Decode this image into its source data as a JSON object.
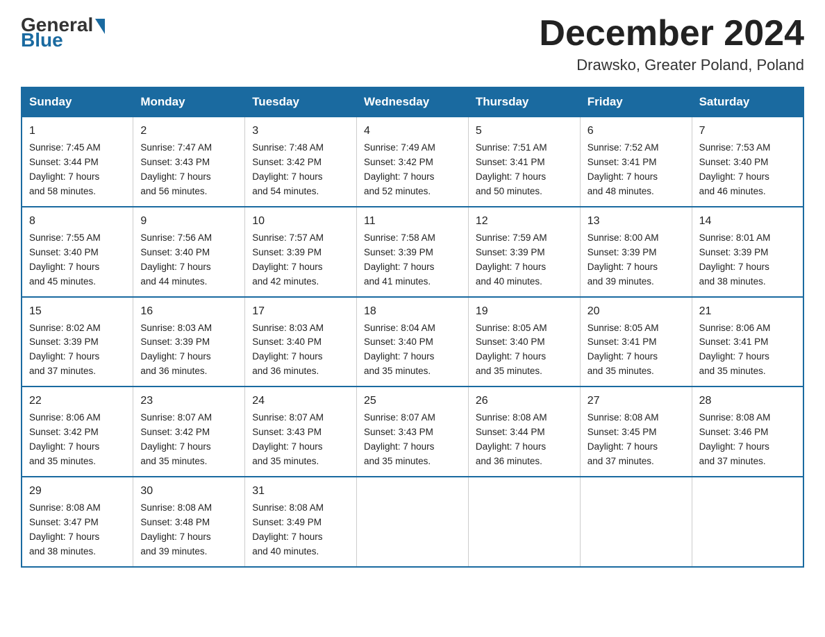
{
  "logo": {
    "general": "General",
    "blue": "Blue",
    "arrow_color": "#1a6aa0"
  },
  "header": {
    "month_title": "December 2024",
    "location": "Drawsko, Greater Poland, Poland"
  },
  "days_of_week": [
    "Sunday",
    "Monday",
    "Tuesday",
    "Wednesday",
    "Thursday",
    "Friday",
    "Saturday"
  ],
  "weeks": [
    [
      {
        "day": "1",
        "sunrise": "7:45 AM",
        "sunset": "3:44 PM",
        "daylight": "7 hours and 58 minutes."
      },
      {
        "day": "2",
        "sunrise": "7:47 AM",
        "sunset": "3:43 PM",
        "daylight": "7 hours and 56 minutes."
      },
      {
        "day": "3",
        "sunrise": "7:48 AM",
        "sunset": "3:42 PM",
        "daylight": "7 hours and 54 minutes."
      },
      {
        "day": "4",
        "sunrise": "7:49 AM",
        "sunset": "3:42 PM",
        "daylight": "7 hours and 52 minutes."
      },
      {
        "day": "5",
        "sunrise": "7:51 AM",
        "sunset": "3:41 PM",
        "daylight": "7 hours and 50 minutes."
      },
      {
        "day": "6",
        "sunrise": "7:52 AM",
        "sunset": "3:41 PM",
        "daylight": "7 hours and 48 minutes."
      },
      {
        "day": "7",
        "sunrise": "7:53 AM",
        "sunset": "3:40 PM",
        "daylight": "7 hours and 46 minutes."
      }
    ],
    [
      {
        "day": "8",
        "sunrise": "7:55 AM",
        "sunset": "3:40 PM",
        "daylight": "7 hours and 45 minutes."
      },
      {
        "day": "9",
        "sunrise": "7:56 AM",
        "sunset": "3:40 PM",
        "daylight": "7 hours and 44 minutes."
      },
      {
        "day": "10",
        "sunrise": "7:57 AM",
        "sunset": "3:39 PM",
        "daylight": "7 hours and 42 minutes."
      },
      {
        "day": "11",
        "sunrise": "7:58 AM",
        "sunset": "3:39 PM",
        "daylight": "7 hours and 41 minutes."
      },
      {
        "day": "12",
        "sunrise": "7:59 AM",
        "sunset": "3:39 PM",
        "daylight": "7 hours and 40 minutes."
      },
      {
        "day": "13",
        "sunrise": "8:00 AM",
        "sunset": "3:39 PM",
        "daylight": "7 hours and 39 minutes."
      },
      {
        "day": "14",
        "sunrise": "8:01 AM",
        "sunset": "3:39 PM",
        "daylight": "7 hours and 38 minutes."
      }
    ],
    [
      {
        "day": "15",
        "sunrise": "8:02 AM",
        "sunset": "3:39 PM",
        "daylight": "7 hours and 37 minutes."
      },
      {
        "day": "16",
        "sunrise": "8:03 AM",
        "sunset": "3:39 PM",
        "daylight": "7 hours and 36 minutes."
      },
      {
        "day": "17",
        "sunrise": "8:03 AM",
        "sunset": "3:40 PM",
        "daylight": "7 hours and 36 minutes."
      },
      {
        "day": "18",
        "sunrise": "8:04 AM",
        "sunset": "3:40 PM",
        "daylight": "7 hours and 35 minutes."
      },
      {
        "day": "19",
        "sunrise": "8:05 AM",
        "sunset": "3:40 PM",
        "daylight": "7 hours and 35 minutes."
      },
      {
        "day": "20",
        "sunrise": "8:05 AM",
        "sunset": "3:41 PM",
        "daylight": "7 hours and 35 minutes."
      },
      {
        "day": "21",
        "sunrise": "8:06 AM",
        "sunset": "3:41 PM",
        "daylight": "7 hours and 35 minutes."
      }
    ],
    [
      {
        "day": "22",
        "sunrise": "8:06 AM",
        "sunset": "3:42 PM",
        "daylight": "7 hours and 35 minutes."
      },
      {
        "day": "23",
        "sunrise": "8:07 AM",
        "sunset": "3:42 PM",
        "daylight": "7 hours and 35 minutes."
      },
      {
        "day": "24",
        "sunrise": "8:07 AM",
        "sunset": "3:43 PM",
        "daylight": "7 hours and 35 minutes."
      },
      {
        "day": "25",
        "sunrise": "8:07 AM",
        "sunset": "3:43 PM",
        "daylight": "7 hours and 35 minutes."
      },
      {
        "day": "26",
        "sunrise": "8:08 AM",
        "sunset": "3:44 PM",
        "daylight": "7 hours and 36 minutes."
      },
      {
        "day": "27",
        "sunrise": "8:08 AM",
        "sunset": "3:45 PM",
        "daylight": "7 hours and 37 minutes."
      },
      {
        "day": "28",
        "sunrise": "8:08 AM",
        "sunset": "3:46 PM",
        "daylight": "7 hours and 37 minutes."
      }
    ],
    [
      {
        "day": "29",
        "sunrise": "8:08 AM",
        "sunset": "3:47 PM",
        "daylight": "7 hours and 38 minutes."
      },
      {
        "day": "30",
        "sunrise": "8:08 AM",
        "sunset": "3:48 PM",
        "daylight": "7 hours and 39 minutes."
      },
      {
        "day": "31",
        "sunrise": "8:08 AM",
        "sunset": "3:49 PM",
        "daylight": "7 hours and 40 minutes."
      },
      null,
      null,
      null,
      null
    ]
  ],
  "labels": {
    "sunrise": "Sunrise:",
    "sunset": "Sunset:",
    "daylight": "Daylight:"
  }
}
